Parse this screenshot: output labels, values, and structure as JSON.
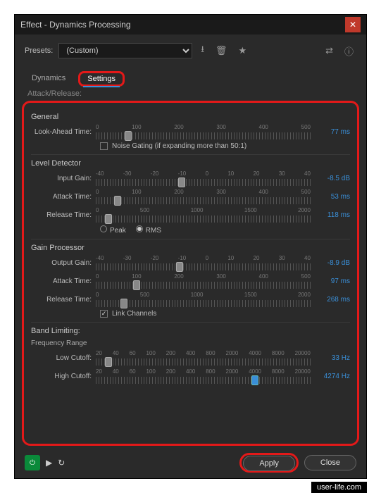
{
  "window": {
    "title": "Effect - Dynamics Processing"
  },
  "presets": {
    "label": "Presets:",
    "value": "(Custom)"
  },
  "tabs": {
    "dynamics": "Dynamics",
    "settings": "Settings",
    "attackRelease": "Attack/Release:"
  },
  "general": {
    "title": "General",
    "lookAhead": {
      "label": "Look-Ahead Time:",
      "ticks": [
        "0",
        "100",
        "200",
        "300",
        "400",
        "500"
      ],
      "value": "77",
      "unit": "ms",
      "pos": 15
    },
    "noiseGating": {
      "label": "Noise Gating (if expanding more than 50:1)",
      "checked": false
    }
  },
  "levelDetector": {
    "title": "Level Detector",
    "inputGain": {
      "label": "Input Gain:",
      "ticks": [
        "-40",
        "-30",
        "-20",
        "-10",
        "0",
        "10",
        "20",
        "30",
        "40"
      ],
      "value": "-8.5",
      "unit": "dB",
      "pos": 40
    },
    "attack": {
      "label": "Attack Time:",
      "ticks": [
        "0",
        "100",
        "200",
        "300",
        "400",
        "500"
      ],
      "value": "53",
      "unit": "ms",
      "pos": 10
    },
    "release": {
      "label": "Release Time:",
      "ticks": [
        "0",
        "500",
        "1000",
        "1500",
        "2000"
      ],
      "value": "118",
      "unit": "ms",
      "pos": 6
    },
    "peak": "Peak",
    "rms": "RMS"
  },
  "gainProcessor": {
    "title": "Gain Processor",
    "outputGain": {
      "label": "Output Gain:",
      "ticks": [
        "-40",
        "-30",
        "-20",
        "-10",
        "0",
        "10",
        "20",
        "30",
        "40"
      ],
      "value": "-8.9",
      "unit": "dB",
      "pos": 39
    },
    "attack": {
      "label": "Attack Time:",
      "ticks": [
        "0",
        "100",
        "200",
        "300",
        "400",
        "500"
      ],
      "value": "97",
      "unit": "ms",
      "pos": 19
    },
    "release": {
      "label": "Release Time:",
      "ticks": [
        "0",
        "500",
        "1000",
        "1500",
        "2000"
      ],
      "value": "268",
      "unit": "ms",
      "pos": 13
    },
    "linkChannels": {
      "label": "Link Channels",
      "checked": true
    }
  },
  "bandLimiting": {
    "title": "Band Limiting:",
    "freqRange": "Frequency Range",
    "lowCutoff": {
      "label": "Low Cutoff:",
      "ticks": [
        "20",
        "40",
        "60",
        "100",
        "200",
        "400",
        "800",
        "2000",
        "4000",
        "8000",
        "20000"
      ],
      "value": "33",
      "unit": "Hz",
      "pos": 6
    },
    "highCutoff": {
      "label": "High Cutoff:",
      "ticks": [
        "20",
        "40",
        "60",
        "100",
        "200",
        "400",
        "800",
        "2000",
        "4000",
        "8000",
        "20000"
      ],
      "value": "4274",
      "unit": "Hz",
      "pos": 74
    }
  },
  "buttons": {
    "apply": "Apply",
    "close": "Close"
  },
  "watermark": "user-life.com"
}
